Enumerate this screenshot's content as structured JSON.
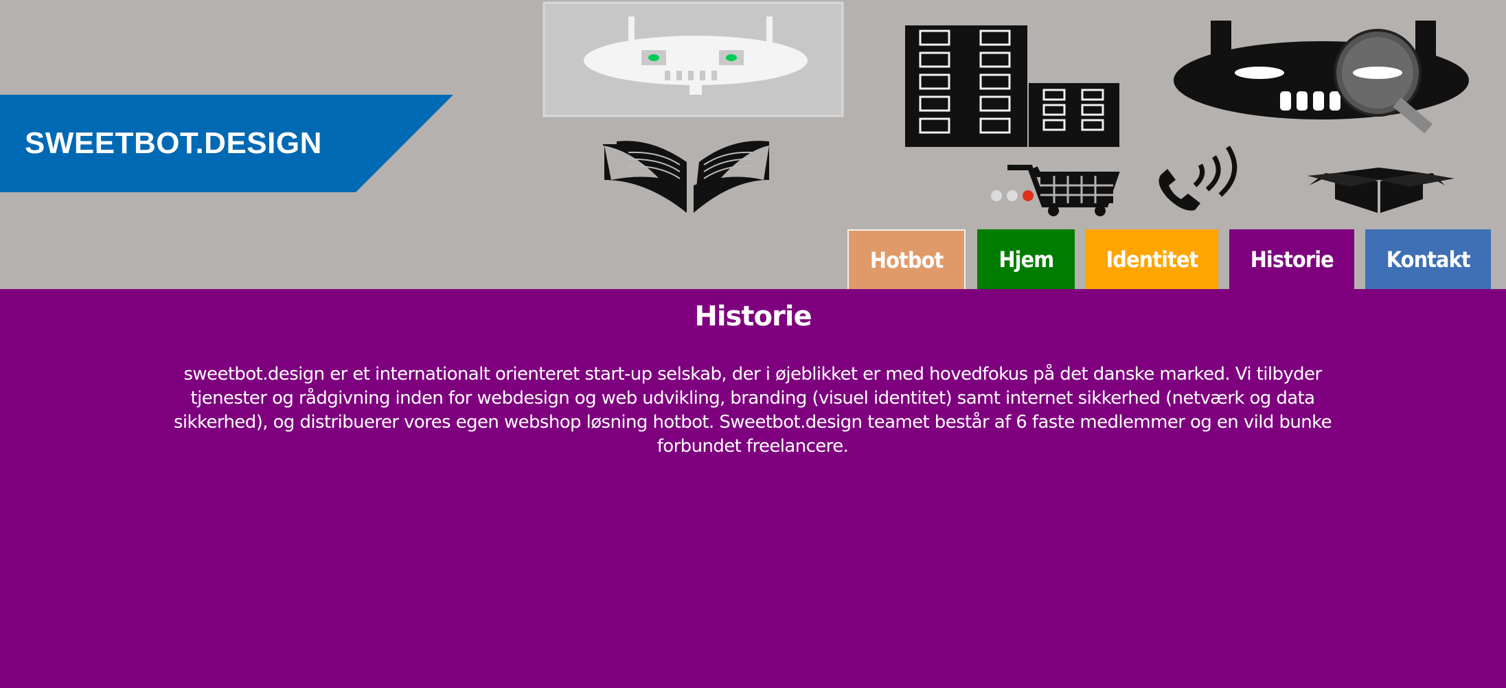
{
  "brand": {
    "logo_text": "SWEETBOT.DESIGN",
    "banner_color": "#0069b4"
  },
  "header": {
    "background": "#b5b1ae",
    "icons": [
      "robot-face-icon",
      "buildings-icon",
      "magnifier-robot-icon",
      "open-book-icon",
      "shopping-cart-icon",
      "phone-icon",
      "open-box-icon"
    ]
  },
  "nav": {
    "tabs": [
      {
        "label": "Hotbot",
        "color": "#e09a6a"
      },
      {
        "label": "Hjem",
        "color": "#007d00"
      },
      {
        "label": "Identitet",
        "color": "#ffa500"
      },
      {
        "label": "Historie",
        "color": "#7e007e",
        "active": true
      },
      {
        "label": "Kontakt",
        "color": "#3f6fb5"
      }
    ]
  },
  "main": {
    "background": "#7e007e",
    "title": "Historie",
    "body": "sweetbot.design er et internationalt orienteret start-up selskab, der i øjeblikket er med hovedfokus på det danske marked. Vi tilbyder tjenester og rådgivning inden for webdesign og web udvikling, branding (visuel identitet) samt internet sikkerhed (netværk og data sikkerhed), og distribuerer vores egen webshop løsning hotbot. Sweetbot.design teamet består af 6 faste medlemmer og en vild bunke forbundet freelancere."
  }
}
